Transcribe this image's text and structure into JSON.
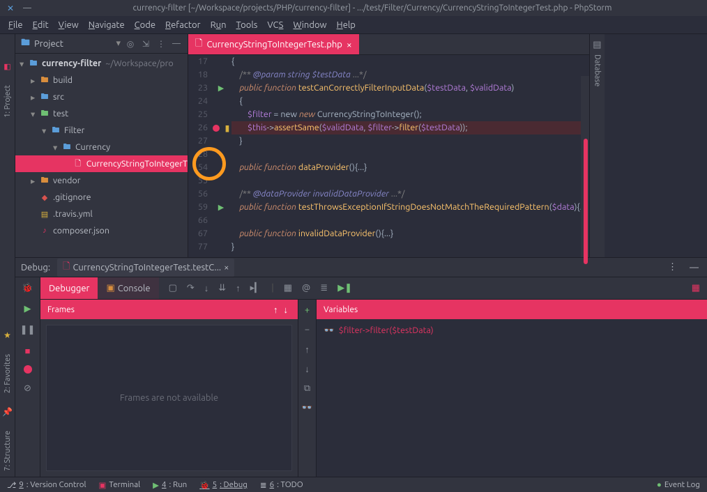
{
  "window": {
    "title": "currency-filter [~/Workspace/projects/PHP/currency-filter] - .../test/Filter/Currency/CurrencyStringToIntegerTest.php - PhpStorm"
  },
  "menu": {
    "file": "File",
    "edit": "Edit",
    "view": "View",
    "navigate": "Navigate",
    "code": "Code",
    "refactor": "Refactor",
    "run": "Run",
    "tools": "Tools",
    "vcs": "VCS",
    "window": "Window",
    "help": "Help"
  },
  "projectPanel": {
    "title": "Project",
    "root": {
      "name": "currency-filter",
      "path": "~/Workspace/pro"
    },
    "tree": {
      "build": "build",
      "src": "src",
      "test": "test",
      "filter": "Filter",
      "currency": "Currency",
      "testfile": "CurrencyStringToIntegerT",
      "vendor": "vendor",
      "gitignore": ".gitignore",
      "travis": ".travis.yml",
      "composer": "composer.json"
    }
  },
  "sidebars": {
    "left": "1: Project",
    "right": "Database",
    "leftStrip": {
      "favorites": "2: Favorites",
      "structure": "7: Structure"
    }
  },
  "editor": {
    "tab": "CurrencyStringToIntegerTest.php",
    "lines": {
      "l17": "17",
      "l18": "18",
      "l23": "23",
      "l24": "24",
      "l25": "25",
      "l26": "26",
      "l27": "27",
      "l28": "28",
      "l54": "54",
      "l55": "55",
      "l56": "56",
      "l59": "59",
      "l66": "66",
      "l67": "67",
      "l77": "77"
    },
    "code": {
      "c17": "{",
      "c18_cmt": "/** @param string $testData ...*/",
      "c23_pub": "public function",
      "c23_fn": "testCanCorrectlyFilterInputData",
      "c23_args": "($testData, $validData)",
      "c24": "{",
      "c25_var": "$filter",
      "c25_new": " = new ",
      "c25_cls": "CurrencyStringToInteger",
      "c25_end": "();",
      "c26_this": "$this",
      "c26_arrow": "->",
      "c26_assert": "assertSame",
      "c26_open": "(",
      "c26_valid": "$validData",
      "c26_comma": ", ",
      "c26_filter": "$filter",
      "c26_call": "->",
      "c26_method": "filter",
      "c26_open2": "(",
      "c26_td": "$testData",
      "c26_close": "));",
      "c27": "}",
      "c54_pub": "public function",
      "c54_fn": "dataProvider",
      "c54_body": "(){...}",
      "c56_cmt": "/** @dataProvider invalidDataProvider ...*/",
      "c59_pub": "public function",
      "c59_fn": "testThrowsExceptionIfStringDoesNotMatchTheRequiredPattern",
      "c59_args": "($data)",
      "c59_body": "{...}",
      "c67_pub": "public function",
      "c67_fn": "invalidDataProvider",
      "c67_body": "(){...}",
      "c77": "}"
    }
  },
  "debug": {
    "title": "Debug:",
    "tab": "CurrencyStringToIntegerTest.testC...",
    "tabs": {
      "debugger": "Debugger",
      "console": "Console"
    },
    "frames": {
      "title": "Frames",
      "empty": "Frames are not available"
    },
    "variables": {
      "title": "Variables",
      "watch": "$filter->filter($testData)"
    }
  },
  "statusbar": {
    "vcs": "9: Version Control",
    "terminal": "Terminal",
    "run": "4: Run",
    "debug": "5: Debug",
    "todo": "6: TODO",
    "eventlog": "Event Log"
  }
}
